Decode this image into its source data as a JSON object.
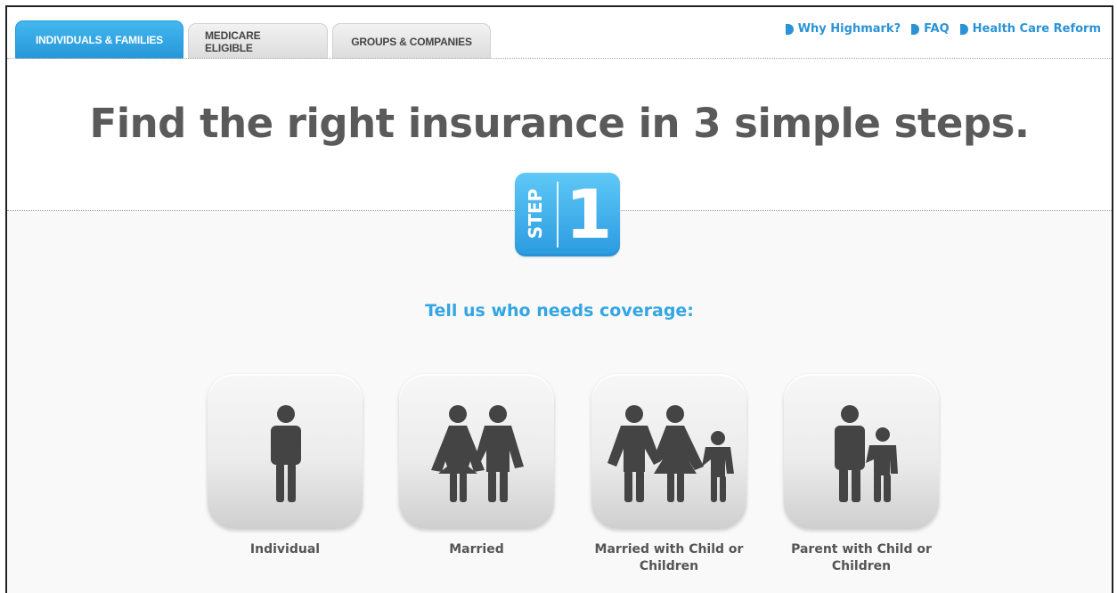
{
  "tabs": [
    {
      "label": "INDIVIDUALS & FAMILIES",
      "active": true
    },
    {
      "label": "MEDICARE ELIGIBLE",
      "active": false
    },
    {
      "label": "GROUPS & COMPANIES",
      "active": false
    }
  ],
  "top_links": [
    {
      "label": "Why Highmark?",
      "icon": "arrow-icon"
    },
    {
      "label": "FAQ",
      "icon": "arrow-icon"
    },
    {
      "label": "Health Care Reform",
      "icon": "arrow-icon"
    }
  ],
  "headline": "Find the right insurance in 3 simple steps.",
  "step": {
    "word": "STEP",
    "number": "1"
  },
  "prompt": "Tell us who needs coverage:",
  "options": [
    {
      "label": "Individual",
      "icon": "individual-icon"
    },
    {
      "label": "Married",
      "icon": "married-couple-icon"
    },
    {
      "label": "Married with Child or Children",
      "icon": "family-icon"
    },
    {
      "label": "Parent with Child or Children",
      "icon": "parent-child-icon"
    }
  ],
  "colors": {
    "accent": "#2a93d5",
    "tab_active": "#2597d9",
    "headline": "#5a5a5a",
    "figure": "#444444"
  }
}
